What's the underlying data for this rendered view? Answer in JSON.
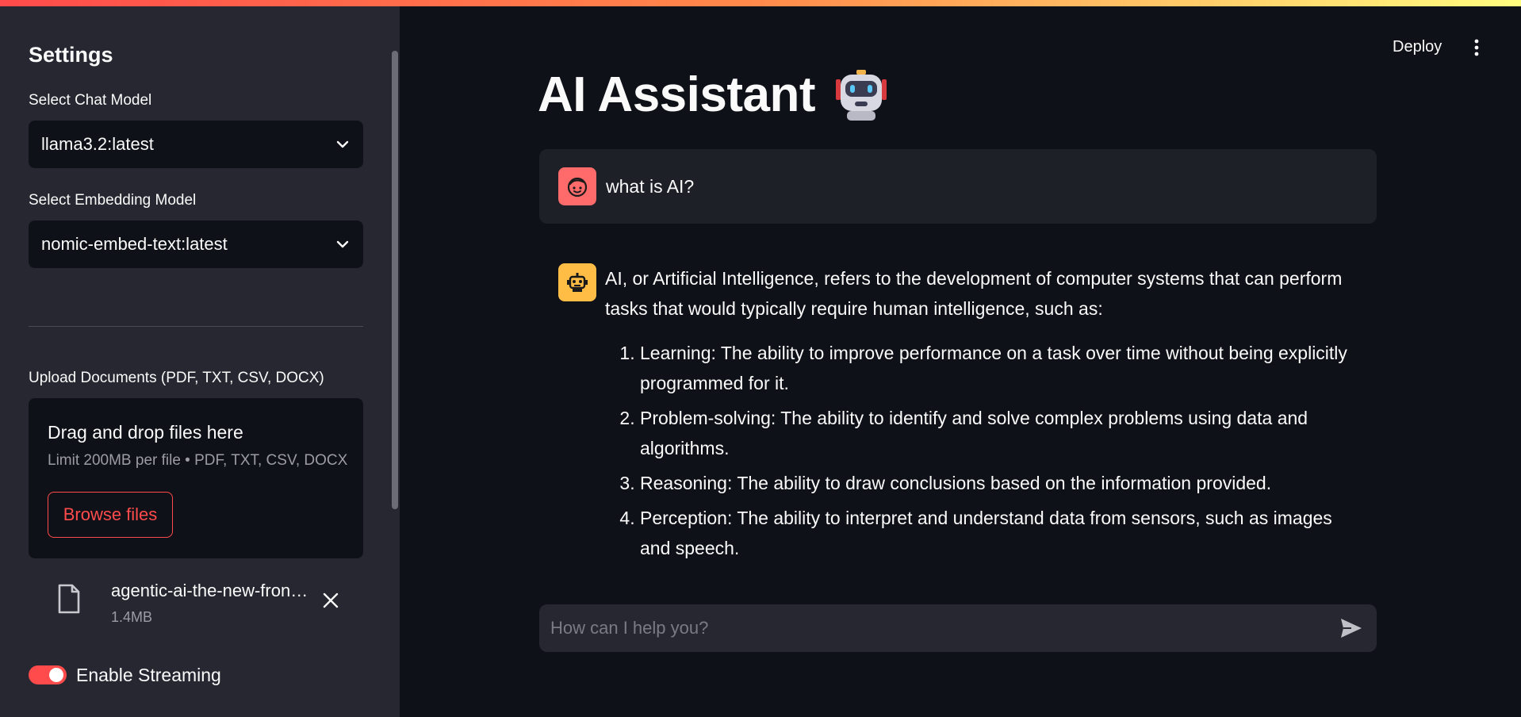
{
  "sidebar": {
    "title": "Settings",
    "chat_model_label": "Select Chat Model",
    "chat_model_value": "llama3.2:latest",
    "embedding_model_label": "Select Embedding Model",
    "embedding_model_value": "nomic-embed-text:latest",
    "upload_label": "Upload Documents (PDF, TXT, CSV, DOCX)",
    "upload_title": "Drag and drop files here",
    "upload_limit": "Limit 200MB per file • PDF, TXT, CSV, DOCX",
    "browse_label": "Browse files",
    "file_name": "agentic-ai-the-new-fron…",
    "file_size": "1.4MB",
    "streaming_label": "Enable Streaming",
    "streaming_enabled": true
  },
  "header": {
    "deploy_label": "Deploy"
  },
  "main": {
    "title": "AI Assistant",
    "messages": [
      {
        "role": "user",
        "text": "what is AI?"
      },
      {
        "role": "assistant",
        "intro": "AI, or Artificial Intelligence, refers to the development of computer systems that can perform tasks that would typically require human intelligence, such as:",
        "items": [
          "Learning: The ability to improve performance on a task over time without being explicitly programmed for it.",
          "Problem-solving: The ability to identify and solve complex problems using data and algorithms.",
          "Reasoning: The ability to draw conclusions based on the information provided.",
          "Perception: The ability to interpret and understand data from sensors, such as images and speech."
        ]
      }
    ],
    "input_placeholder": "How can I help you?"
  },
  "colors": {
    "accent": "#ff4b4b",
    "user_avatar": "#ff6b6b",
    "assistant_avatar": "#ffbd45",
    "background": "#0e1117",
    "sidebar": "#262730"
  },
  "icons": {
    "select_arrow": "chevron-down-icon",
    "file": "file-icon",
    "remove_file": "close-icon",
    "menu": "kebab-menu-icon",
    "send": "send-icon",
    "user_avatar": "user-face-icon",
    "assistant_avatar": "robot-icon",
    "title_emoji": "robot-emoji"
  }
}
